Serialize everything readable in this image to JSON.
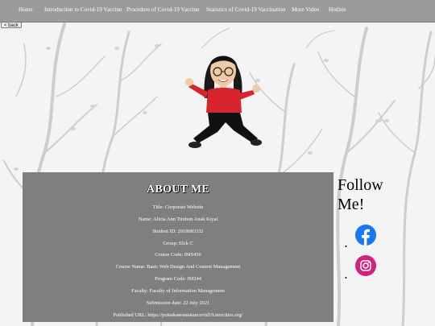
{
  "nav": {
    "items": [
      {
        "label": "Home"
      },
      {
        "label": "Introduction to Covid-19 Vaccine"
      },
      {
        "label": "Procedure of Covid-19 Vaccine"
      },
      {
        "label": "Statistics of Covid-19 Vaccination"
      },
      {
        "label": "More Video"
      },
      {
        "label": "Hotline"
      }
    ]
  },
  "back_button": {
    "label": "< back"
  },
  "avatar": {
    "icon": "bitmoji-avatar-icon"
  },
  "about": {
    "title": "ABOUT ME",
    "lines": [
      "Title: Corporate Website",
      "Name: Alicia Ann Timbun Anak Kiyai",
      "Student ID: 2018683332",
      "Group: Elck C",
      "Course Code: IMS456",
      "Course Name: Basic Web Design And Content Management",
      "Program Code: IM244",
      "Faculty: Faculty of Information Management",
      "Submission date: 22 July 2021",
      "Published URL: https://putuskanrantaiancovid19.neocities.org/"
    ]
  },
  "follow": {
    "title_line1": "Follow",
    "title_line2": "Me!",
    "bullet": "•",
    "links": [
      {
        "icon": "facebook-icon",
        "color": "#1877f2"
      },
      {
        "icon": "instagram-icon",
        "color": "#d6207d"
      }
    ]
  },
  "colors": {
    "navbar": "#9b9b9b",
    "about_panel": "#7f7f7f",
    "branches": "#c9c9c9"
  }
}
